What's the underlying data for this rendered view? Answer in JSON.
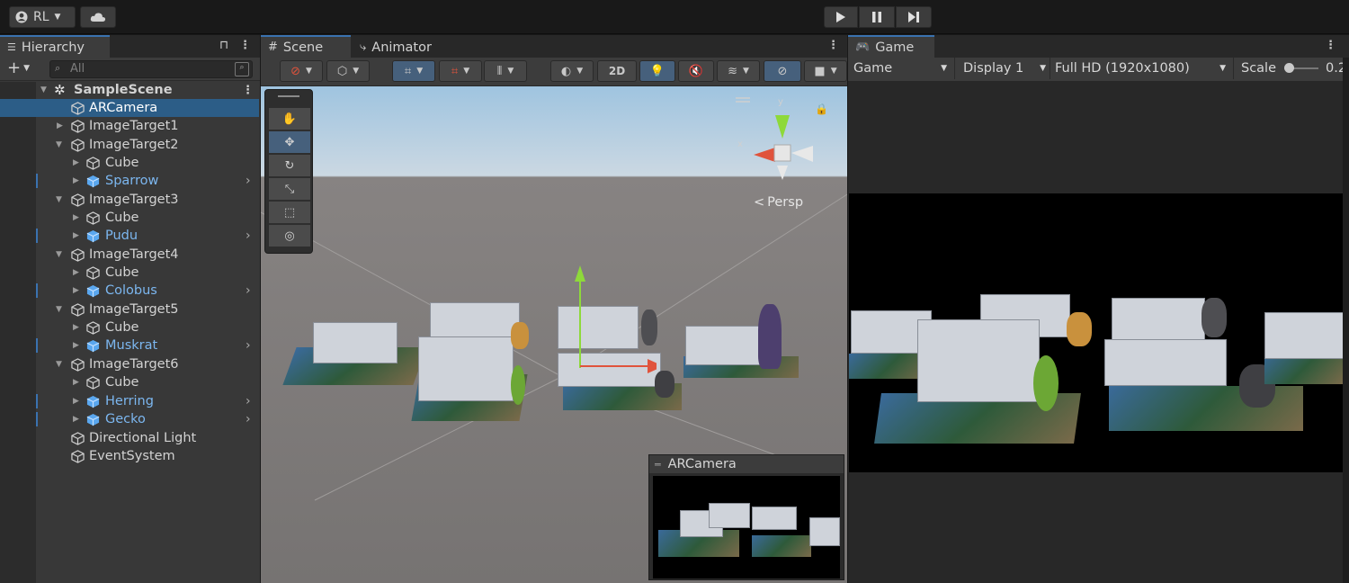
{
  "toolbar": {
    "account_label": "RL",
    "play_icon": "play-icon",
    "pause_icon": "pause-icon",
    "step_icon": "step-icon"
  },
  "hierarchy": {
    "tab_label": "Hierarchy",
    "search_placeholder": "All",
    "scene_name": "SampleScene",
    "items": [
      {
        "label": "ARCamera"
      },
      {
        "label": "ImageTarget1"
      },
      {
        "label": "ImageTarget2"
      },
      {
        "label": "Cube"
      },
      {
        "label": "Sparrow"
      },
      {
        "label": "ImageTarget3"
      },
      {
        "label": "Cube"
      },
      {
        "label": "Pudu"
      },
      {
        "label": "ImageTarget4"
      },
      {
        "label": "Cube"
      },
      {
        "label": "Colobus"
      },
      {
        "label": "ImageTarget5"
      },
      {
        "label": "Cube"
      },
      {
        "label": "Muskrat"
      },
      {
        "label": "ImageTarget6"
      },
      {
        "label": "Cube"
      },
      {
        "label": "Herring"
      },
      {
        "label": "Gecko"
      },
      {
        "label": "Directional Light"
      },
      {
        "label": "EventSystem"
      }
    ]
  },
  "scene": {
    "tab_scene": "Scene",
    "tab_animator": "Animator",
    "btn_2d": "2D",
    "persp_label": "Persp",
    "gizmo_y": "y",
    "gizmo_x": "x",
    "camera_preview_title": "ARCamera"
  },
  "game": {
    "tab_label": "Game",
    "mode": "Game",
    "display": "Display 1",
    "resolution": "Full HD (1920x1080)",
    "scale_label": "Scale",
    "scale_value": "0.2"
  },
  "colors": {
    "selection": "#2c5d87",
    "prefab_blue": "#7cb7f0",
    "accent_blue": "#3a72b0"
  }
}
